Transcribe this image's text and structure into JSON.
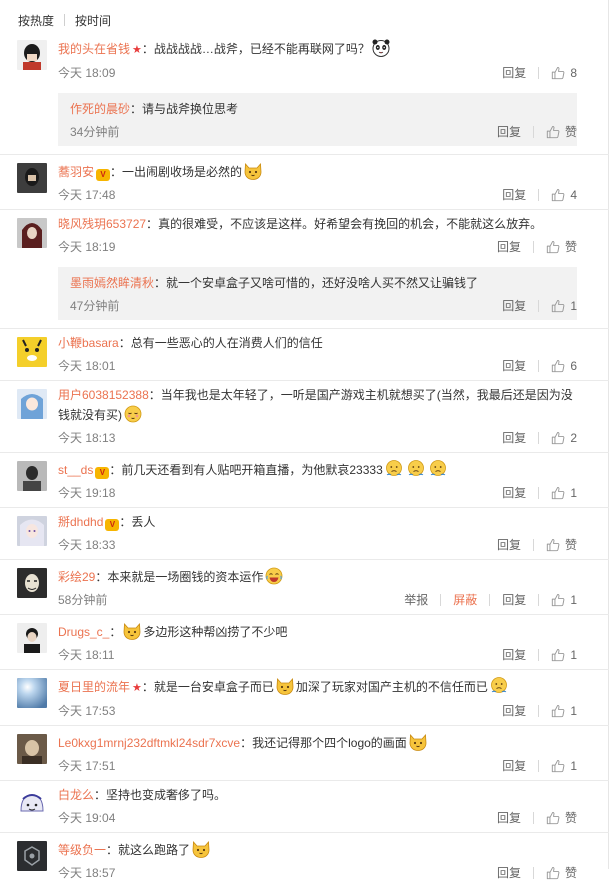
{
  "sort": {
    "by_heat": "按热度",
    "by_time": "按时间"
  },
  "labels": {
    "reply": "回复",
    "like_text": "赞",
    "report": "举报",
    "block": "屏蔽",
    "colon": "："
  },
  "comments": [
    {
      "user": "我的头在省钱",
      "badge": "star",
      "text": "战战战战…战斧，已经不能再联网了吗？",
      "time": "今天 18:09",
      "likes": "8",
      "reply": {
        "user": "作死的晨砂",
        "text": "请与战斧换位思考",
        "time": "34分钟前",
        "likes": "赞"
      }
    },
    {
      "user": "蕎羽安",
      "badge": "vip",
      "text": "一出闹剧收场是必然的",
      "time": "今天 17:48",
      "likes": "4"
    },
    {
      "user": "晓风残玥653727",
      "badge": "",
      "text": "真的很难受，不应该是这样。好希望会有挽回的机会，不能就这么放弃。",
      "time": "今天 18:19",
      "likes": "赞",
      "reply": {
        "user": "墨雨嫣然眸清秋",
        "text": "就一个安卓盒子又啥可惜的，还好没啥人买不然又让骗钱了",
        "time": "47分钟前",
        "likes": "1"
      }
    },
    {
      "user": "小鞭basara",
      "badge": "",
      "text": "总有一些恶心的人在消费人们的信任",
      "time": "今天 18:01",
      "likes": "6"
    },
    {
      "user": "用户6038152388",
      "badge": "",
      "text": "当年我也是太年轻了，一听是国产游戏主机就想买了(当然，我最后还是因为没钱就没有买)",
      "time": "今天 18:13",
      "likes": "2"
    },
    {
      "user": "st__ds",
      "badge": "vip",
      "text": "前几天还看到有人贴吧开箱直播，为他默哀23333",
      "time": "今天 19:18",
      "likes": "1"
    },
    {
      "user": "掰dhdhd",
      "badge": "vip",
      "text": "丢人",
      "time": "今天 18:33",
      "likes": "赞"
    },
    {
      "user": "彩绘29",
      "badge": "",
      "text": "本来就是一场圈钱的资本运作",
      "time": "58分钟前",
      "likes": "1"
    },
    {
      "user": "Drugs_c_",
      "badge": "",
      "text": "多边形这种帮凶捞了不少吧",
      "time": "今天 18:11",
      "likes": "1"
    },
    {
      "user": "夏日里的流年",
      "badge": "star",
      "text": "就是一台安卓盒子而已",
      "text2": "加深了玩家对国产主机的不信任而已",
      "time": "今天 17:53",
      "likes": "1"
    },
    {
      "user": "Le0kxg1mrnj232dftmkl24sdr7xcve",
      "badge": "",
      "text": "我还记得那个四个logo的画面",
      "time": "今天 17:51",
      "likes": "1"
    },
    {
      "user": "白龙么",
      "badge": "",
      "text": "坚持也变成奢侈了吗。",
      "time": "今天 19:04",
      "likes": "赞"
    },
    {
      "user": "等级负一",
      "badge": "",
      "text": "就这么跑路了",
      "time": "今天 18:57",
      "likes": "赞"
    }
  ]
}
